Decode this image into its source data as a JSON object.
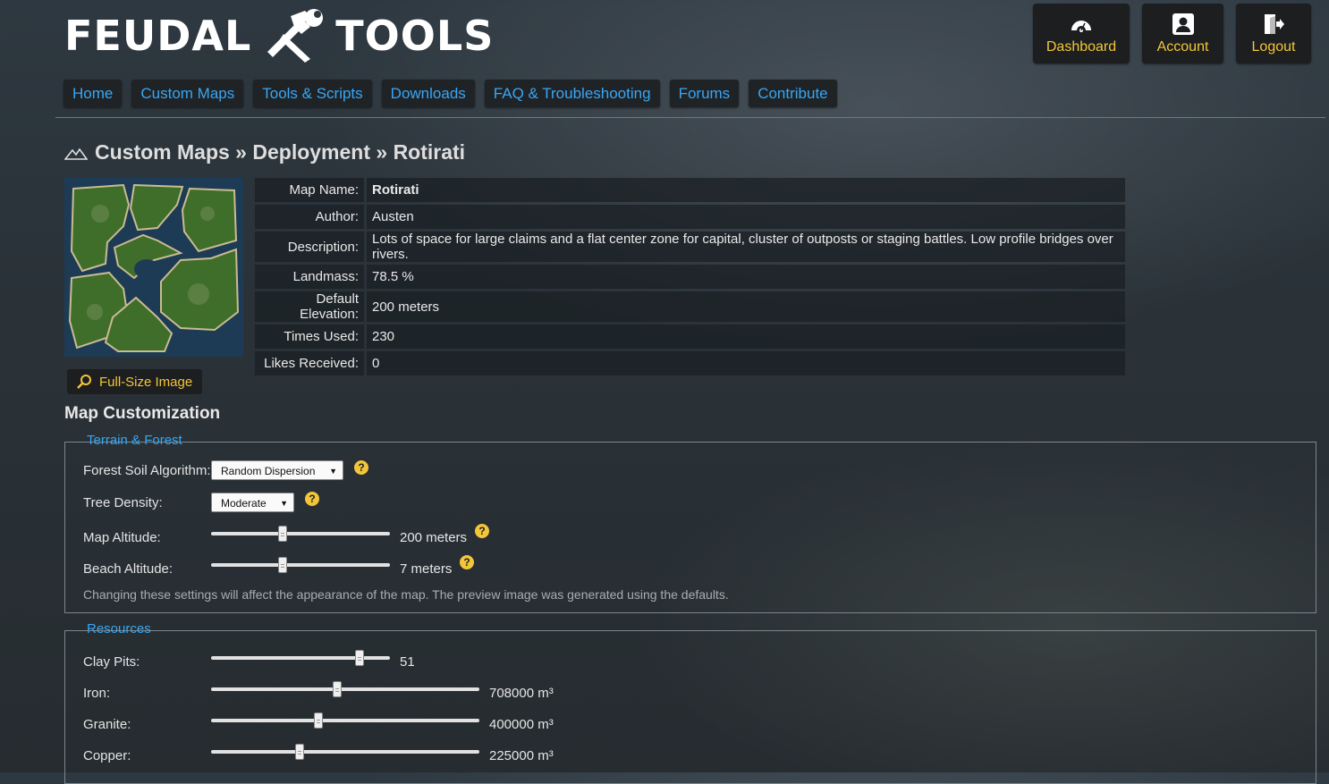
{
  "header": {
    "logo_left": "FEUDAL",
    "logo_right": "TOOLS",
    "buttons": [
      {
        "label": "Dashboard",
        "icon": "gauge-icon"
      },
      {
        "label": "Account",
        "icon": "account-icon"
      },
      {
        "label": "Logout",
        "icon": "logout-icon"
      }
    ]
  },
  "nav": [
    "Home",
    "Custom Maps",
    "Tools & Scripts",
    "Downloads",
    "FAQ & Troubleshooting",
    "Forums",
    "Contribute"
  ],
  "breadcrumb": "Custom Maps » Deployment » Rotirati",
  "info": [
    {
      "key": "Map Name:",
      "value": "Rotirati"
    },
    {
      "key": "Author:",
      "value": "Austen"
    },
    {
      "key": "Description:",
      "value": "Lots of space for large claims and a flat center zone for capital, cluster of outposts or staging battles. Low profile bridges over rivers."
    },
    {
      "key": "Landmass:",
      "value": "78.5 %"
    },
    {
      "key": "Default Elevation:",
      "value": "200 meters"
    },
    {
      "key": "Times Used:",
      "value": "230"
    },
    {
      "key": "Likes Received:",
      "value": "0"
    }
  ],
  "full_size_button": "Full-Size Image",
  "customization": {
    "title": "Map Customization",
    "terrain": {
      "legend": "Terrain & Forest",
      "forest_soil": {
        "label": "Forest Soil Algorithm:",
        "value": "Random Dispersion"
      },
      "tree_density": {
        "label": "Tree Density:",
        "value": "Moderate"
      },
      "map_altitude": {
        "label": "Map Altitude:",
        "value": "200 meters",
        "level": 0.4
      },
      "beach_altitude": {
        "label": "Beach Altitude:",
        "value": "7 meters",
        "level": 0.4
      },
      "note": "Changing these settings will affect the appearance of the map. The preview image was generated using the defaults.",
      "help": "?"
    },
    "resources": {
      "legend": "Resources",
      "items": [
        {
          "label": "Clay Pits:",
          "value": "51",
          "level": 0.83
        },
        {
          "label": "Iron:",
          "value": "708000 m³",
          "level": 0.47
        },
        {
          "label": "Granite:",
          "value": "400000 m³",
          "level": 0.4
        },
        {
          "label": "Copper:",
          "value": "225000 m³",
          "level": 0.33
        }
      ]
    }
  },
  "colors": {
    "accent_blue": "#39a6f4",
    "accent_yellow": "#f3c63a"
  }
}
